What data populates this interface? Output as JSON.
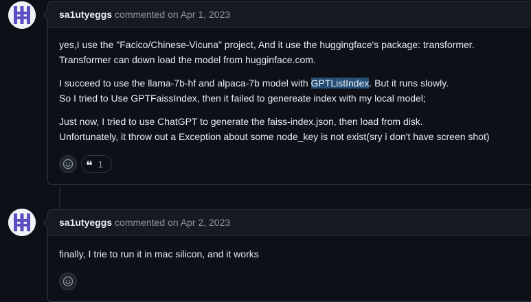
{
  "comments": [
    {
      "author": "sa1utyeggs",
      "action": "commented on Apr 1, 2023",
      "paragraphs": [
        {
          "line1": "yes,I use the \"Facico/Chinese-Vicuna\" project, And it use the huggingface's package: transformer.",
          "line2": "Transformer can down load the model from hugginface.com."
        },
        {
          "line1_before": "I succeed to use the llama-7b-hf and alpaca-7b model with ",
          "line1_selected": "GPTListIndex",
          "line1_after": ". But it runs slowly.",
          "line2": "So I tried to Use GPTFaissIndex, then it failed to genereate index with my local model;"
        },
        {
          "line1": "Just now, I tried to use ChatGPT to generate the faiss-index.json, then load from disk.",
          "line2": "Unfortunately, it throw out a Exception about some node_key is not exist(sry i don't have screen shot)"
        }
      ],
      "reactions": {
        "add_icon": "smiley-icon",
        "emoji": "❝",
        "count": "1"
      }
    },
    {
      "author": "sa1utyeggs",
      "action": "commented on Apr 2, 2023",
      "text": "finally, I trie to run it in mac silicon, and it works",
      "reactions": {
        "add_icon": "smiley-icon"
      }
    }
  ],
  "colors": {
    "background": "#0d1117",
    "header": "#161b22",
    "border": "#30363d",
    "selection": "#264f78",
    "avatar_purple": "#5d4fc3"
  }
}
